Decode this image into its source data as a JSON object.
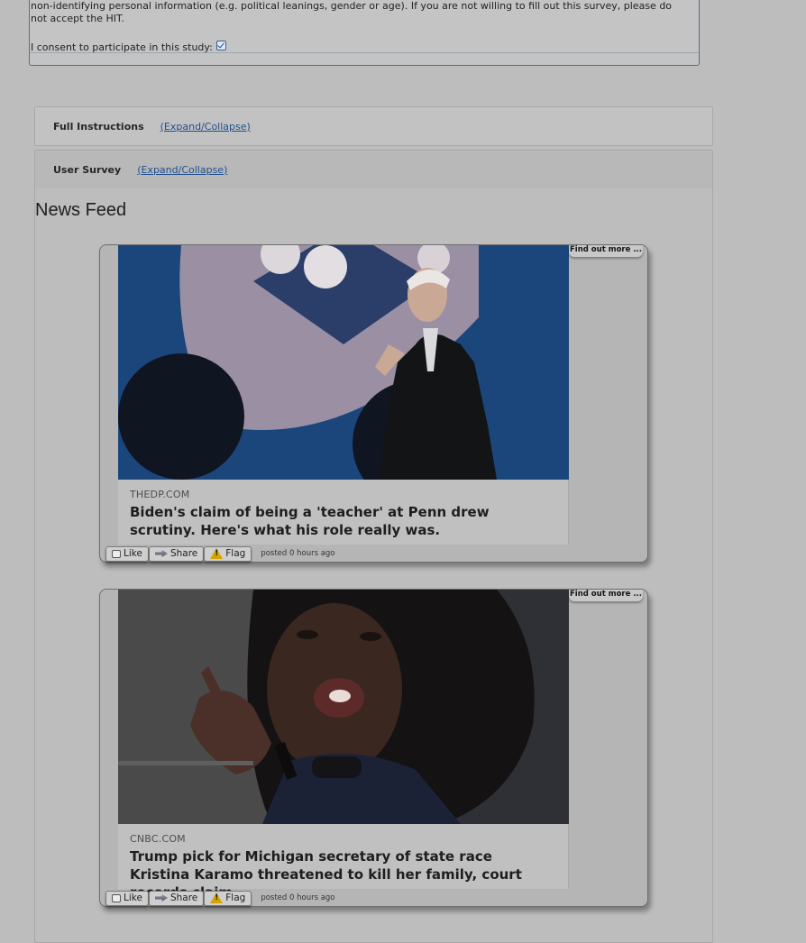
{
  "consent": {
    "text": "non-identifying personal information (e.g. political leanings, gender or age). If you are not willing to fill out this survey, please do not accept the HIT.",
    "label": "I consent to participate in this study:",
    "checked": true
  },
  "panels": {
    "instructions": {
      "title": "Full Instructions",
      "toggle": "(Expand/Collapse)"
    },
    "survey": {
      "title": "User Survey",
      "toggle": "(Expand/Collapse)"
    }
  },
  "feed": {
    "heading": "News Feed",
    "posts": [
      {
        "source": "THEDP.COM",
        "title": "Biden's claim of being a 'teacher' at Penn drew scrutiny. Here's what his role really was.",
        "find_out": "Find out more ...",
        "like": "Like",
        "share": "Share",
        "flag": "Flag",
        "posted": "posted 0 hours ago"
      },
      {
        "source": "CNBC.COM",
        "title": "Trump pick for Michigan secretary of state race Kristina Karamo threatened to kill her family, court records claim",
        "find_out": "Find out more ...",
        "like": "Like",
        "share": "Share",
        "flag": "Flag",
        "posted": "posted 0 hours ago"
      }
    ]
  },
  "colors": {
    "link": "#1e4f8f",
    "dim_overlay": "#bdbdbd"
  },
  "icons": {
    "like": "thumbs-up-icon",
    "share": "share-arrow-icon",
    "flag": "warning-icon"
  }
}
